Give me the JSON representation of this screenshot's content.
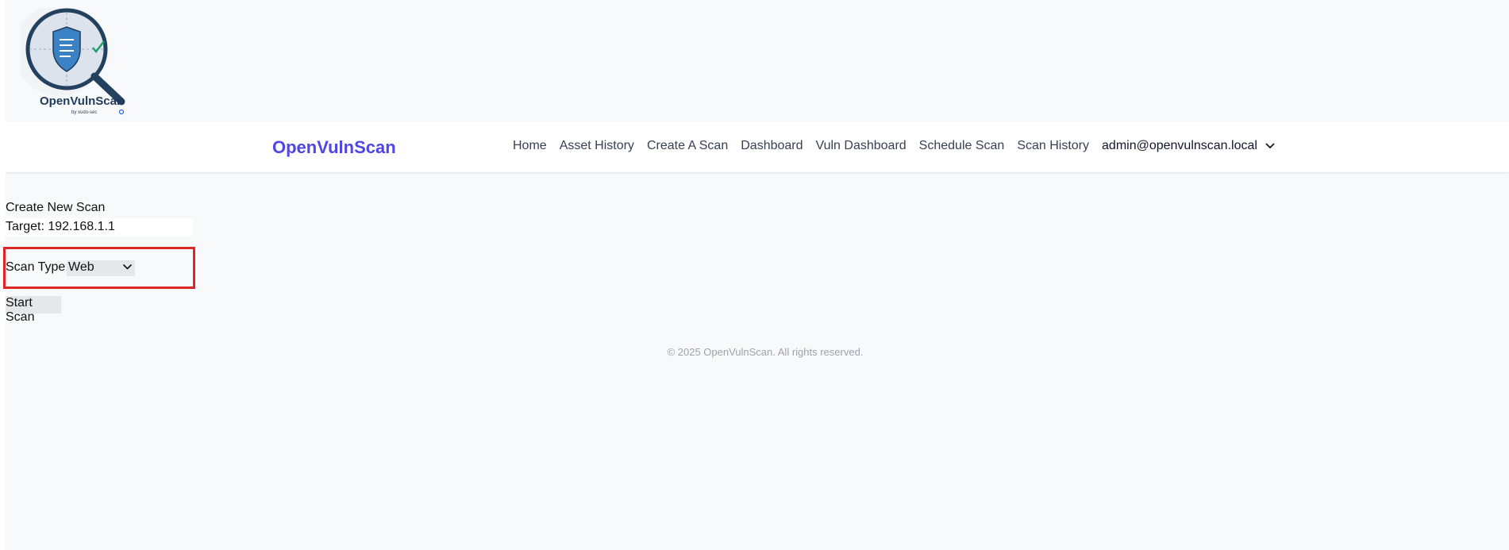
{
  "logo": {
    "wordmark": "OpenVulnScan",
    "tagline": "by xudo-sec",
    "icon": "shield-magnifier-icon"
  },
  "navbar": {
    "brand": "OpenVulnScan",
    "links": [
      {
        "label": "Home"
      },
      {
        "label": "Asset History"
      },
      {
        "label": "Create A Scan"
      },
      {
        "label": "Dashboard"
      },
      {
        "label": "Vuln Dashboard"
      },
      {
        "label": "Schedule Scan"
      },
      {
        "label": "Scan History"
      }
    ],
    "user": "admin@openvulnscan.local",
    "user_icon": "chevron-down-icon"
  },
  "form": {
    "title": "Create New Scan",
    "target_value": "Target: 192.168.1.1",
    "scan_type_label": "Scan Type:",
    "scan_type_value": "Web",
    "start_label": "Start Scan"
  },
  "footer": {
    "text": "© 2025 OpenVulnScan. All rights reserved."
  },
  "colors": {
    "brand": "#4f46e5",
    "highlight": "#dc2626",
    "page_bg": "#f8f9fb"
  }
}
